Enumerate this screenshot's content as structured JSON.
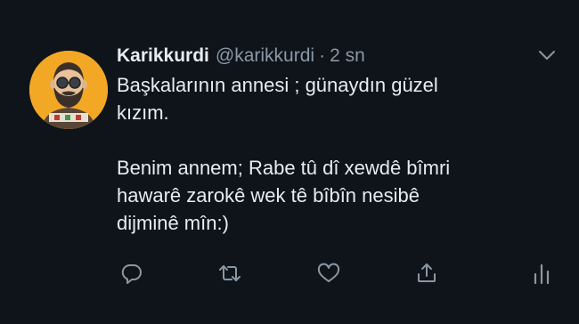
{
  "tweet": {
    "display_name": "Karikkurdi",
    "handle": "@karikkurdi",
    "separator": "·",
    "time": "2 sn",
    "text_line_1": "Başkalarının annesi ; günaydın güzel",
    "text_line_2": "kızım.",
    "text_line_3": "Benim annem; Rabe tû dî xewdê bîmri",
    "text_line_4": "hawarê zarokê wek tê bîbîn nesibê",
    "text_line_5": "dijminê mîn:)"
  },
  "avatar": {
    "background_color": "#f2a824",
    "icon": "bearded-man-with-glasses-avatar"
  },
  "actions": [
    {
      "name": "reply-icon"
    },
    {
      "name": "retweet-icon"
    },
    {
      "name": "like-icon"
    },
    {
      "name": "share-icon"
    },
    {
      "name": "analytics-icon"
    }
  ],
  "colors": {
    "background": "#0f141b",
    "primary_text": "#e9ebee",
    "secondary_text": "#8a97a4",
    "icon": "#8a97a4"
  }
}
